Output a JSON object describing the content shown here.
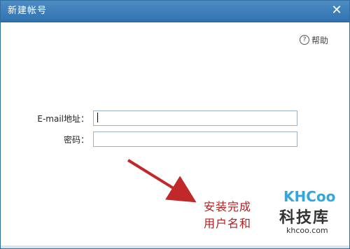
{
  "window": {
    "title": "新建帐号",
    "close_symbol": "✕"
  },
  "help": {
    "icon": "question-circle-icon",
    "label": "帮助"
  },
  "form": {
    "email_label": "E-mail地址：",
    "email_value": "",
    "password_label": "密码：",
    "password_value": ""
  },
  "annotation": {
    "line1": "安装完成",
    "line2": "用户名和",
    "color": "#b02020"
  },
  "watermark": {
    "logo": "KHCoo",
    "name": "科技库",
    "url": "khcoo.com"
  },
  "colors": {
    "titlebar": "#3a7dbb",
    "accent": "#2ea8df"
  }
}
